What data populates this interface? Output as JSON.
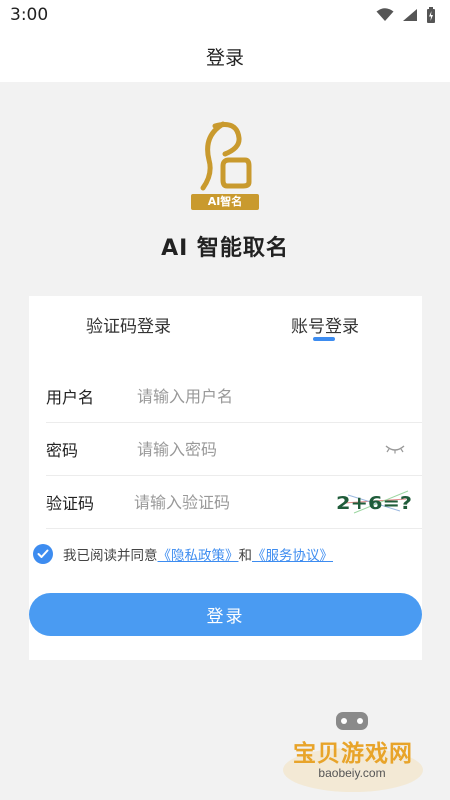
{
  "status_bar": {
    "time": "3:00",
    "icons": [
      "wifi-icon",
      "signal-icon",
      "battery-icon"
    ]
  },
  "header": {
    "title": "登录"
  },
  "brand": {
    "logo_text": "AI智名",
    "app_name": "AI 智能取名"
  },
  "tabs": [
    {
      "label": "验证码登录",
      "active": false
    },
    {
      "label": "账号登录",
      "active": true
    }
  ],
  "form": {
    "username": {
      "label": "用户名",
      "placeholder": "请输入用户名",
      "value": ""
    },
    "password": {
      "label": "密码",
      "placeholder": "请输入密码",
      "value": ""
    },
    "captcha": {
      "label": "验证码",
      "placeholder": "请输入验证码",
      "value": "",
      "image_text": "2+6=?"
    }
  },
  "agreement": {
    "checked": true,
    "prefix": "我已阅读并同意",
    "privacy_link": "《隐私政策》",
    "and": "和",
    "service_link": "《服务协议》"
  },
  "login_button": {
    "label": "登录"
  },
  "watermark": {
    "text": "宝贝游戏网",
    "url": "baobeiy.com"
  },
  "colors": {
    "accent": "#3d8cf0",
    "background": "#f2f2f2",
    "logo_gold": "#c99a2e"
  }
}
